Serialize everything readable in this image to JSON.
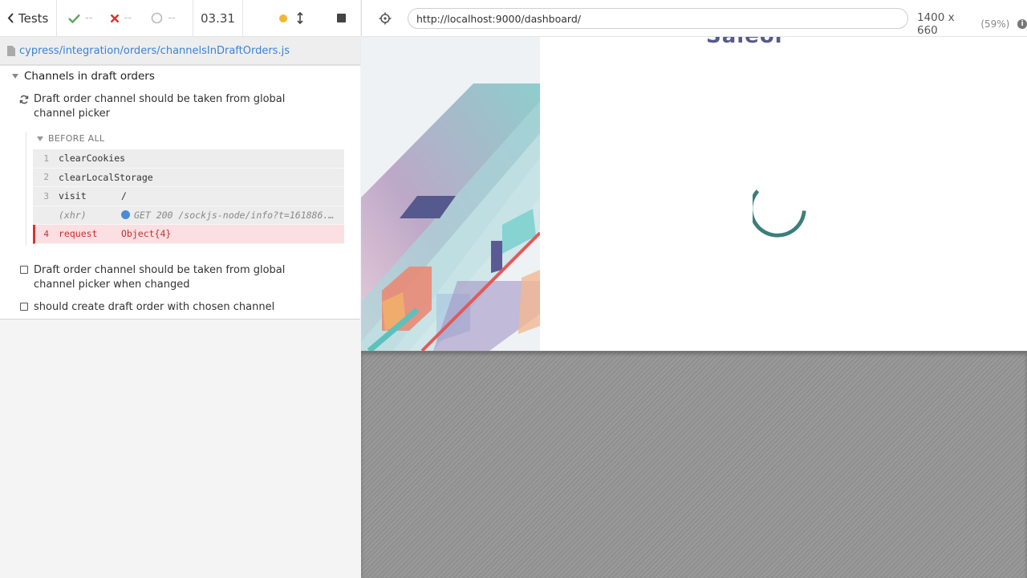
{
  "header": {
    "tests_label": "Tests",
    "passed_count": "--",
    "failed_count": "--",
    "pending_count": "--",
    "duration": "03.31"
  },
  "spec": {
    "file_path": "cypress/integration/orders/channelsInDraftOrders.js"
  },
  "suite": {
    "title": "Channels in draft orders",
    "tests": [
      {
        "title": "Draft order channel should be taken from global channel picker",
        "state": "running"
      },
      {
        "title": "Draft order channel should be taken from global channel picker when changed",
        "state": "pending"
      },
      {
        "title": "should create draft order with chosen channel",
        "state": "pending"
      }
    ],
    "hook_label": "BEFORE ALL",
    "commands": [
      {
        "num": "1",
        "name": "clearCookies",
        "message": ""
      },
      {
        "num": "2",
        "name": "clearLocalStorage",
        "message": ""
      },
      {
        "num": "3",
        "name": "visit",
        "message": "/"
      },
      {
        "num": "",
        "name": "(xhr)",
        "message": "GET 200 /sockjs-node/info?t=161886..."
      },
      {
        "num": "4",
        "name": "request",
        "message": "Object{4}"
      }
    ]
  },
  "aut": {
    "url": "http://localhost:9000/dashboard/",
    "viewport": "1400 x 660",
    "scale": "(59%)",
    "logo_text": "Saleor"
  },
  "colors": {
    "pass": "#5fa75a",
    "fail": "#d7342f",
    "running_dot": "#f2b734",
    "link": "#3b82d4",
    "spinner": "#3b7e7a"
  }
}
